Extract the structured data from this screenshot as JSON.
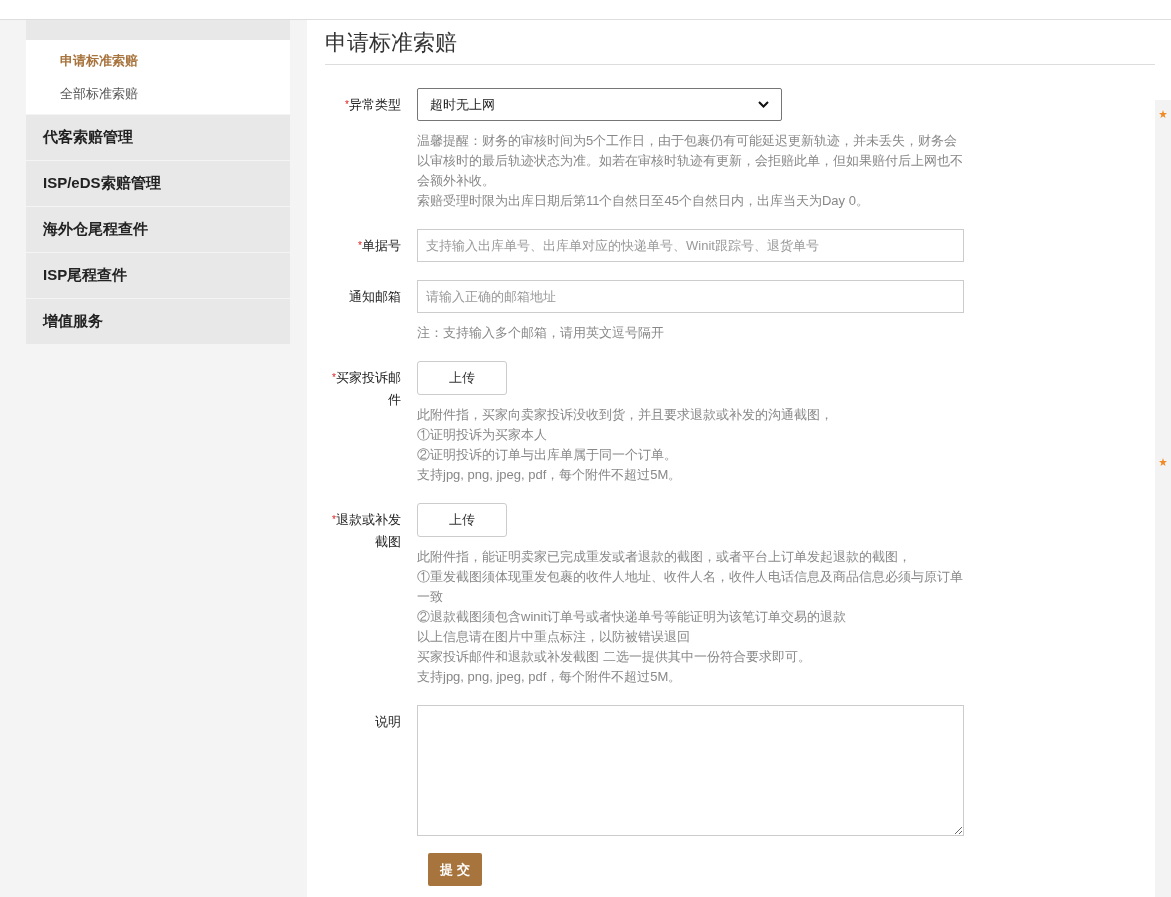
{
  "sidebar": {
    "sub_items": [
      {
        "label": "申请标准索赔",
        "selected": true
      },
      {
        "label": "全部标准索赔",
        "selected": false
      }
    ],
    "items": [
      {
        "label": "代客索赔管理"
      },
      {
        "label": "ISP/eDS索赔管理"
      },
      {
        "label": "海外仓尾程查件"
      },
      {
        "label": "ISP尾程查件"
      },
      {
        "label": "增值服务"
      }
    ]
  },
  "page_title": "申请标准索赔",
  "form": {
    "fields": [
      {
        "kind": "select",
        "label": "异常类型",
        "required_mark": "*",
        "value": "超时无上网",
        "notes": [
          "温馨提醒：财务的审核时间为5个工作日，由于包裹仍有可能延迟更新轨迹，并未丢失，财务会以审核时的最后轨迹状态为准。如若在审核时轨迹有更新，会拒赔此单，但如果赔付后上网也不会额外补收。",
          "索赔受理时限为出库日期后第11个自然日至45个自然日内，出库当天为Day 0。"
        ]
      },
      {
        "kind": "input",
        "label": "单据号",
        "required_mark": "*",
        "placeholder": "支持输入出库单号、出库单对应的快递单号、Winit跟踪号、退货单号"
      },
      {
        "kind": "input",
        "label": "通知邮箱",
        "placeholder": "请输入正确的邮箱地址",
        "notes": [
          "注：支持输入多个邮箱，请用英文逗号隔开"
        ]
      },
      {
        "kind": "upload",
        "label": "买家投诉邮件",
        "required_mark": "*",
        "button": "上传",
        "notes": [
          "此附件指，买家向卖家投诉没收到货，并且要求退款或补发的沟通截图，",
          "①证明投诉为买家本人",
          "②证明投诉的订单与出库单属于同一个订单。",
          "支持jpg, png, jpeg, pdf，每个附件不超过5M。"
        ]
      },
      {
        "kind": "upload",
        "label": "退款或补发截图",
        "required_mark": "*",
        "button": "上传",
        "notes": [
          "此附件指，能证明卖家已完成重发或者退款的截图，或者平台上订单发起退款的截图，",
          "①重发截图须体现重发包裹的收件人地址、收件人名，收件人电话信息及商品信息必须与原订单一致",
          "②退款截图须包含winit订单号或者快递单号等能证明为该笔订单交易的退款",
          "以上信息请在图片中重点标注，以防被错误退回",
          "买家投诉邮件和退款或补发截图 二选一提供其中一份符合要求即可。",
          "支持jpg, png, jpeg, pdf，每个附件不超过5M。"
        ]
      },
      {
        "kind": "textarea",
        "label": "说明"
      }
    ],
    "submit": "提 交"
  }
}
